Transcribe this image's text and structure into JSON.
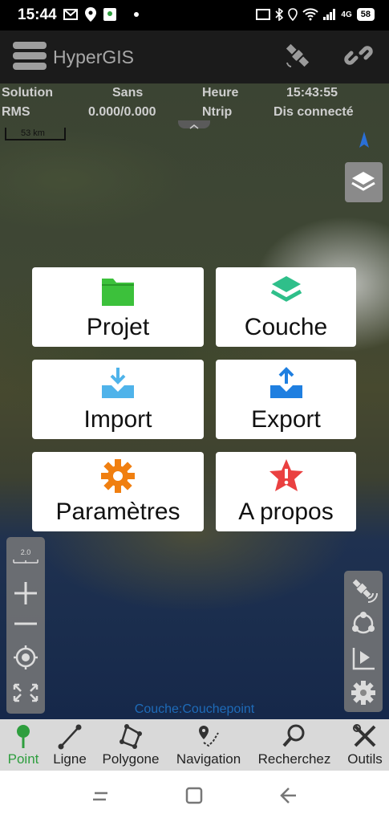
{
  "status_bar": {
    "time": "15:44",
    "network": "4G",
    "battery": "58"
  },
  "app": {
    "title": "HyperGIS"
  },
  "info": {
    "solution_label": "Solution",
    "solution_value": "Sans",
    "time_label": "Heure",
    "time_value": "15:43:55",
    "rms_label": "RMS",
    "rms_value": "0.000/0.000",
    "ntrip_label": "Ntrip",
    "ntrip_value": "Dis connecté"
  },
  "map": {
    "scale": "53 km",
    "zoom_level": "2.0",
    "layer_label": "Couche:Couchepoint"
  },
  "menu": {
    "items": [
      {
        "label": "Projet",
        "icon": "folder-icon",
        "color": "#3cc13b"
      },
      {
        "label": "Couche",
        "icon": "layers-icon",
        "color": "#2fbf8a"
      },
      {
        "label": "Import",
        "icon": "import-icon",
        "color": "#4fb3ea"
      },
      {
        "label": "Export",
        "icon": "export-icon",
        "color": "#1f7fe0"
      },
      {
        "label": "Paramètres",
        "icon": "gear-icon",
        "color": "#f07f10"
      },
      {
        "label": "A propos",
        "icon": "alert-star-icon",
        "color": "#ea4040"
      }
    ]
  },
  "bottom_nav": {
    "items": [
      {
        "label": "Point",
        "icon": "pin-icon",
        "active": true
      },
      {
        "label": "Ligne",
        "icon": "line-icon",
        "active": false
      },
      {
        "label": "Polygone",
        "icon": "polygon-icon",
        "active": false
      },
      {
        "label": "Navigation",
        "icon": "navigation-icon",
        "active": false
      },
      {
        "label": "Recherchez",
        "icon": "search-icon",
        "active": false
      },
      {
        "label": "Outils",
        "icon": "tools-icon",
        "active": false
      }
    ]
  },
  "colors": {
    "active": "#2e9e3e",
    "titlebar": "#1b1b1b",
    "layer_label": "#1e6bb8"
  }
}
